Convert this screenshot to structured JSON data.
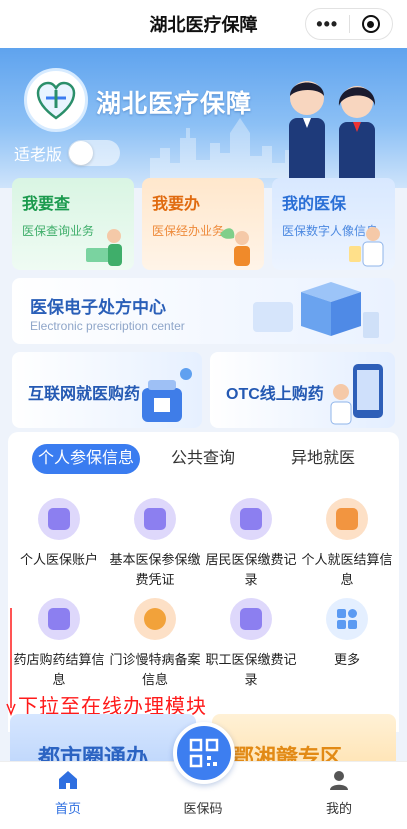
{
  "nav": {
    "title": "湖北医疗保障",
    "more_label": "•••"
  },
  "header": {
    "logo_text": "湖北医疗保障",
    "brand": "湖北医疗保障",
    "elder_mode_label": "适老版",
    "elder_mode_on": false
  },
  "quick_cards": [
    {
      "title": "我要查",
      "subtitle": "医保查询业务"
    },
    {
      "title": "我要办",
      "subtitle": "医保经办业务"
    },
    {
      "title": "我的医保",
      "subtitle": "医保数字人像信息"
    }
  ],
  "banner_rx": {
    "title": "医保电子处方中心",
    "subtitle": "Electronic prescription center"
  },
  "banners_buy": [
    {
      "title": "互联网就医购药"
    },
    {
      "title": "OTC线上购药"
    }
  ],
  "tabs": [
    {
      "label": "个人参保信息",
      "active": true
    },
    {
      "label": "公共查询"
    },
    {
      "label": "异地就医"
    }
  ],
  "services": [
    {
      "label": "个人医保账户",
      "icon": "wallet-icon"
    },
    {
      "label": "基本医保参保缴费凭证",
      "icon": "document-icon"
    },
    {
      "label": "居民医保缴费记录",
      "icon": "yuan-record-icon"
    },
    {
      "label": "个人就医结算信息",
      "icon": "yuan-bag-icon"
    },
    {
      "label": "药店购药结算信息",
      "icon": "yuan-receipt-icon"
    },
    {
      "label": "门诊慢特病备案信息",
      "icon": "sun-icon"
    },
    {
      "label": "职工医保缴费记录",
      "icon": "id-card-icon"
    },
    {
      "label": "更多",
      "icon": "grid-icon"
    }
  ],
  "annotation": {
    "text": "下拉至在线办理模块",
    "color": "#ff1a1a"
  },
  "promos": [
    {
      "title": "都市圈通办"
    },
    {
      "title": "鄂湘赣专区"
    }
  ],
  "tabbar": [
    {
      "label": "首页",
      "active": true
    },
    {
      "label": "医保码"
    },
    {
      "label": "我的"
    }
  ],
  "colors": {
    "accent": "#3a7cf0",
    "hero": "#6aaaf0"
  }
}
